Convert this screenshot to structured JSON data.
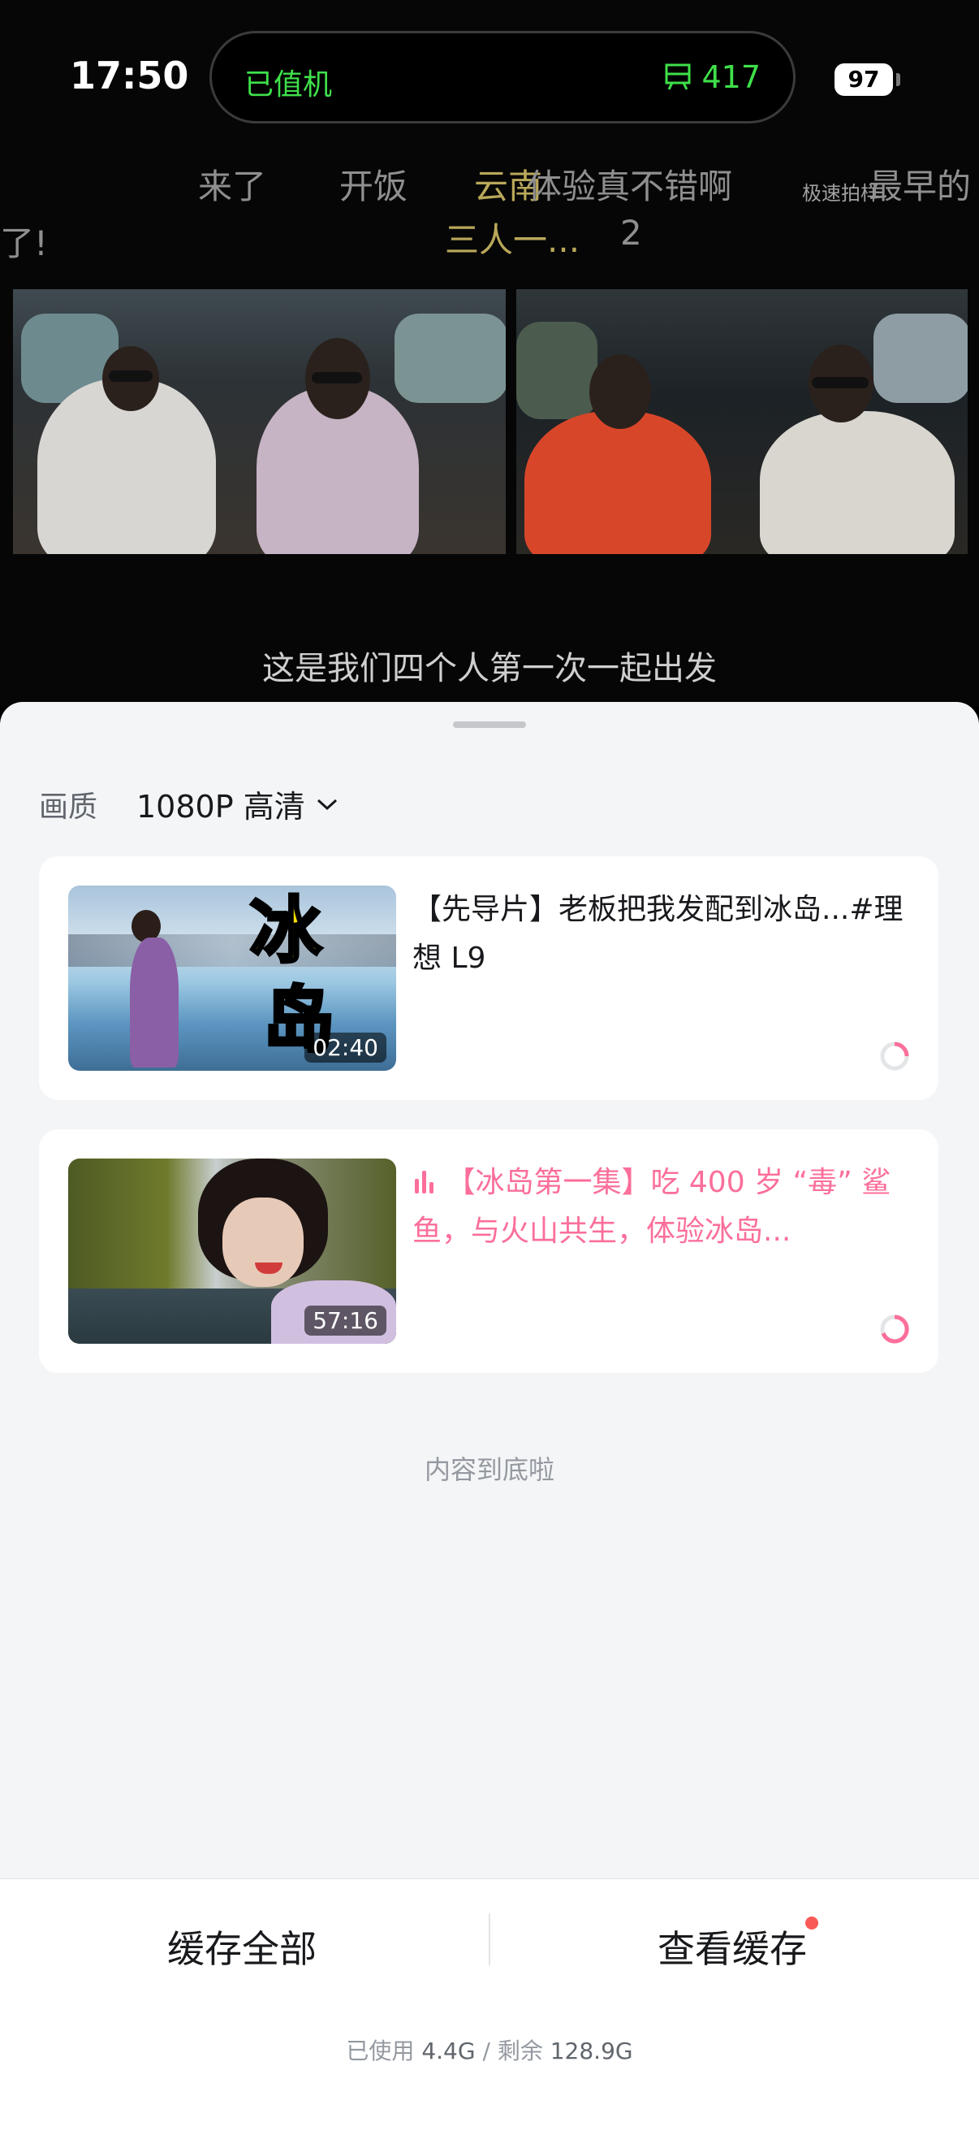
{
  "status_bar": {
    "time": "17:50",
    "island_left": "已值机",
    "island_right": "417",
    "battery": "97"
  },
  "video": {
    "danmaku": [
      "来了",
      "开饭",
      "云南",
      "体验真不错啊",
      "了!",
      "三人一...",
      "2",
      "极速拍样",
      "最早的"
    ],
    "subtitle": "这是我们四个人第一次一起出发"
  },
  "sheet": {
    "quality_label": "画质",
    "quality_value": "1080P 高清",
    "items": [
      {
        "title": "【先导片】老板把我发配到冰岛...#理想 L9",
        "duration": "02:40",
        "thumb_text": "冰岛",
        "state": "normal"
      },
      {
        "title": "【冰岛第一集】吃 400 岁 “毒” 鲨鱼，与火山共生，体验冰岛...",
        "duration": "57:16",
        "state": "playing"
      }
    ],
    "end_text": "内容到底啦",
    "cache_all": "缓存全部",
    "view_cache": "查看缓存",
    "storage": {
      "used_label": "已使用",
      "used": "4.4G",
      "remain_label": "剩余",
      "remain": "128.9G"
    }
  },
  "colors": {
    "accent_pink": "#fb6f9a",
    "island_green": "#3fe04a"
  }
}
